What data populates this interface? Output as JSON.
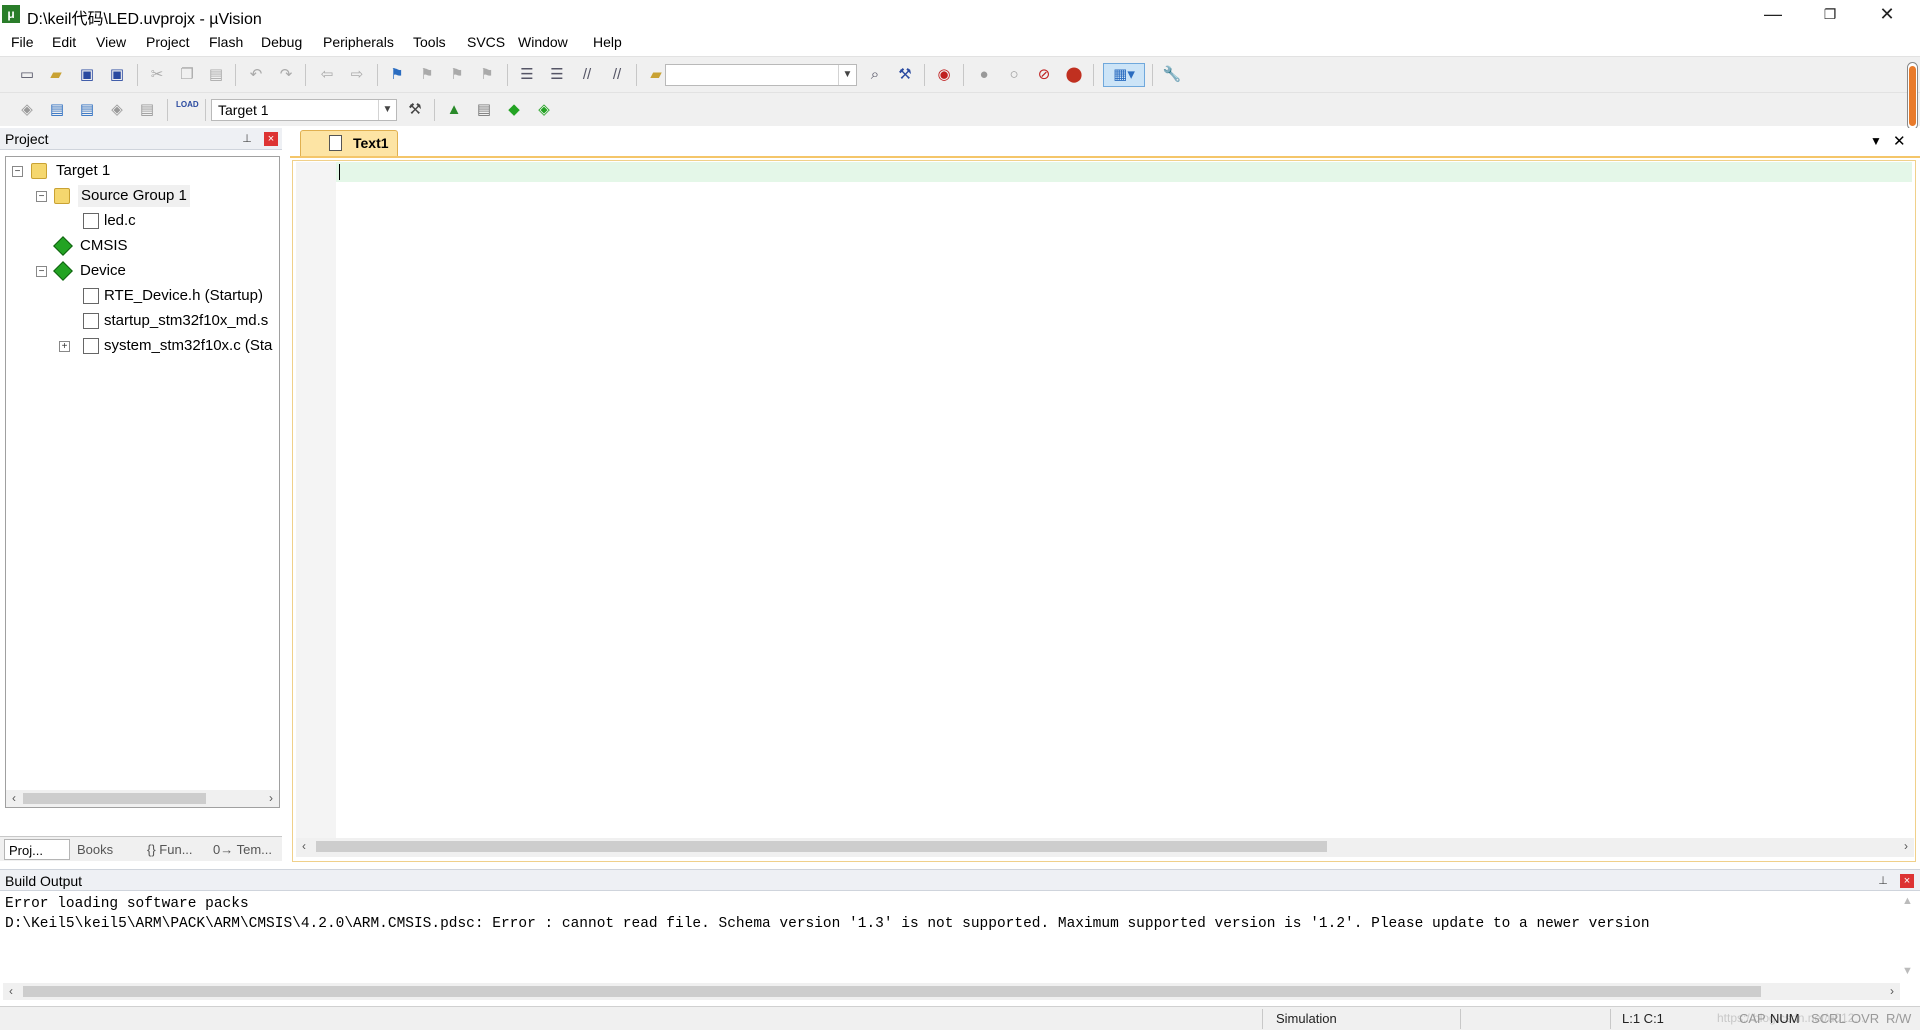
{
  "window": {
    "title": "D:\\keil代码\\LED.uvprojx - µVision",
    "app_icon": "µVision",
    "minimize": "—",
    "restore": "❐",
    "close": "✕"
  },
  "menu": [
    "File",
    "Edit",
    "View",
    "Project",
    "Flash",
    "Debug",
    "Peripherals",
    "Tools",
    "SVCS",
    "Window",
    "Help"
  ],
  "toolbar2": {
    "target_combo": "Target 1",
    "load_label": "LOAD"
  },
  "project_panel": {
    "title": "Project",
    "tree": [
      {
        "label": "Target 1"
      },
      {
        "label": "Source Group 1"
      },
      {
        "label": "led.c"
      },
      {
        "label": "CMSIS"
      },
      {
        "label": "Device"
      },
      {
        "label": "RTE_Device.h (Startup)"
      },
      {
        "label": "startup_stm32f10x_md.s"
      },
      {
        "label": "system_stm32f10x.c (Sta"
      }
    ],
    "tabs": [
      {
        "label": "Proj..."
      },
      {
        "label": "Books"
      },
      {
        "label": "{} Fun..."
      },
      {
        "label": "0→ Tem..."
      }
    ]
  },
  "editor": {
    "tabs": [
      {
        "label": "Text1"
      }
    ]
  },
  "build_output": {
    "title": "Build Output",
    "lines": [
      "Error loading software packs",
      "D:\\Keil5\\keil5\\ARM\\PACK\\ARM\\CMSIS\\4.2.0\\ARM.CMSIS.pdsc: Error : cannot read file. Schema version '1.3' is not supported. Maximum supported version is '1.2'. Please update to a newer version"
    ]
  },
  "status": {
    "mode": "Simulation",
    "position": "L:1 C:1",
    "watermark": "https://blog.csdn.net/u012...",
    "indicators": [
      "CAP",
      "NUM",
      "SCRL",
      "OVR",
      "R/W"
    ]
  },
  "colors": {
    "accent_tab": "#fde4a4",
    "current_line": "#e4f7e8",
    "close_red": "#dd3333"
  }
}
